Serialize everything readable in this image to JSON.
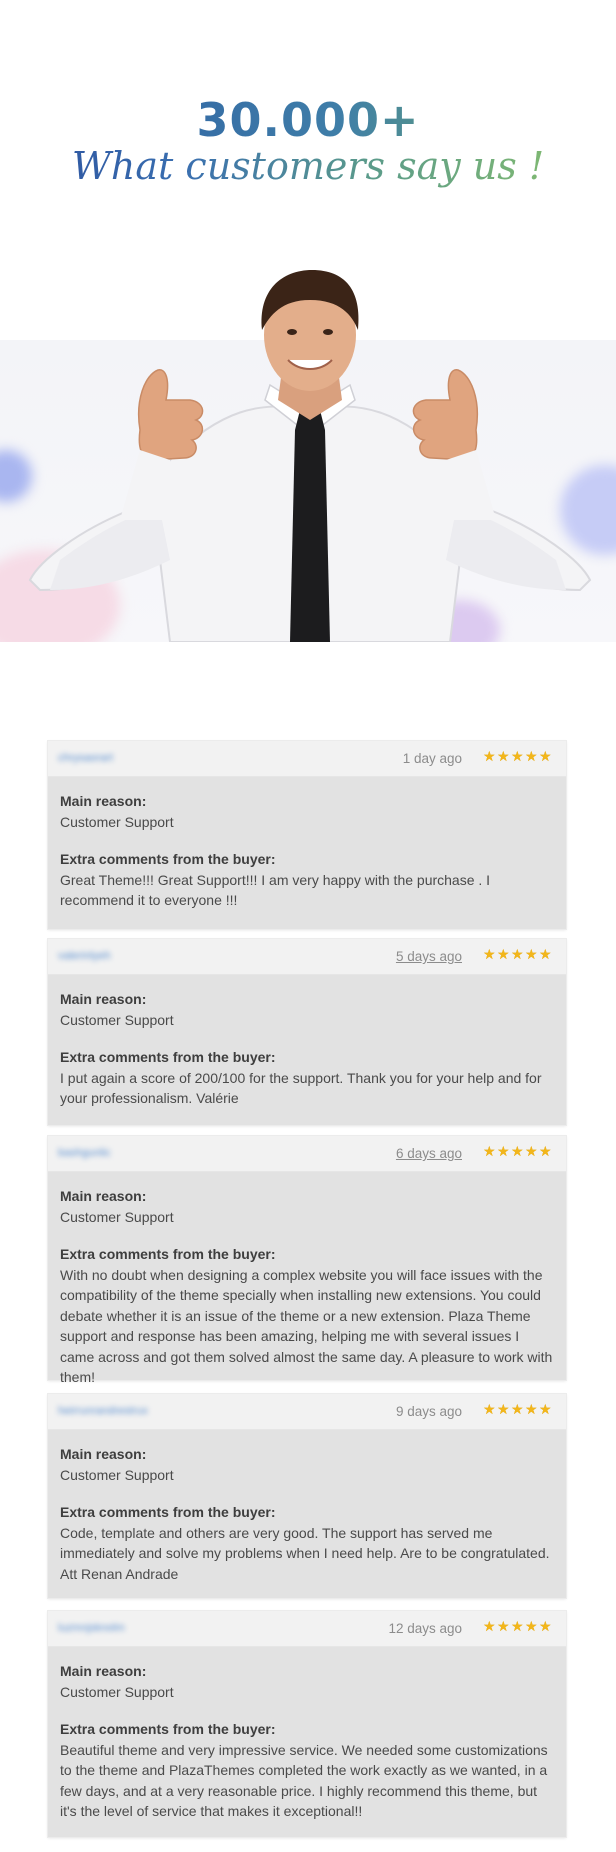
{
  "hero": {
    "count": "30.000+",
    "tagline": "What customers say us !"
  },
  "colors": {
    "star": "#f2b61b",
    "card_bg": "#e2e2e2",
    "header_bg": "#f2f2f2",
    "heading_blue": "#2a58a3",
    "heading_green": "#7ab95a"
  },
  "reviews": [
    {
      "reviewer": "chrysaorart",
      "date": "1 day ago",
      "date_linked": false,
      "rating": 5,
      "main_reason_label": "Main reason:",
      "main_reason": "Customer Support",
      "comments_label": "Extra comments from the buyer:",
      "comments": "Great Theme!!! Great Support!!! I am very happy with the purchase . I recommend it to everyone !!!"
    },
    {
      "reviewer": "valerinlyeh",
      "date": "5 days ago",
      "date_linked": true,
      "rating": 5,
      "main_reason_label": "Main reason:",
      "main_reason": "Customer Support",
      "comments_label": "Extra comments from the buyer:",
      "comments": "I put again a score of 200/100 for the support. Thank you for your help and for your professionalism. Valérie"
    },
    {
      "reviewer": "bashgunlic",
      "date": "6 days ago",
      "date_linked": true,
      "rating": 5,
      "main_reason_label": "Main reason:",
      "main_reason": "Customer Support",
      "comments_label": "Extra comments from the buyer:",
      "comments": "With no doubt when designing a complex website you will face issues with the compatibility of the theme specially when installing new extensions. You could debate whether it is an issue of the theme or a new extension. Plaza Theme support and response has been amazing, helping me with several issues I came across and got them solved almost the same day. A pleasure to work with them!"
    },
    {
      "reviewer": "heirrunrandrestrux",
      "date": "9 days ago",
      "date_linked": false,
      "rating": 5,
      "main_reason_label": "Main reason:",
      "main_reason": "Customer Support",
      "comments_label": "Extra comments from the buyer:",
      "comments": "Code, template and others are very good. The support has served me immediately and solve my problems when I need help. Are to be congratulated. Att Renan Andrade"
    },
    {
      "reviewer": "luzmnjsknolm",
      "date": "12 days ago",
      "date_linked": false,
      "rating": 5,
      "main_reason_label": "Main reason:",
      "main_reason": "Customer Support",
      "comments_label": "Extra comments from the buyer:",
      "comments": "Beautiful theme and very impressive service. We needed some customizations to the theme and PlazaThemes completed the work exactly as we wanted, in a few days, and at a very reasonable price. I highly recommend this theme, but it's the level of service that makes it exceptional!!"
    }
  ]
}
